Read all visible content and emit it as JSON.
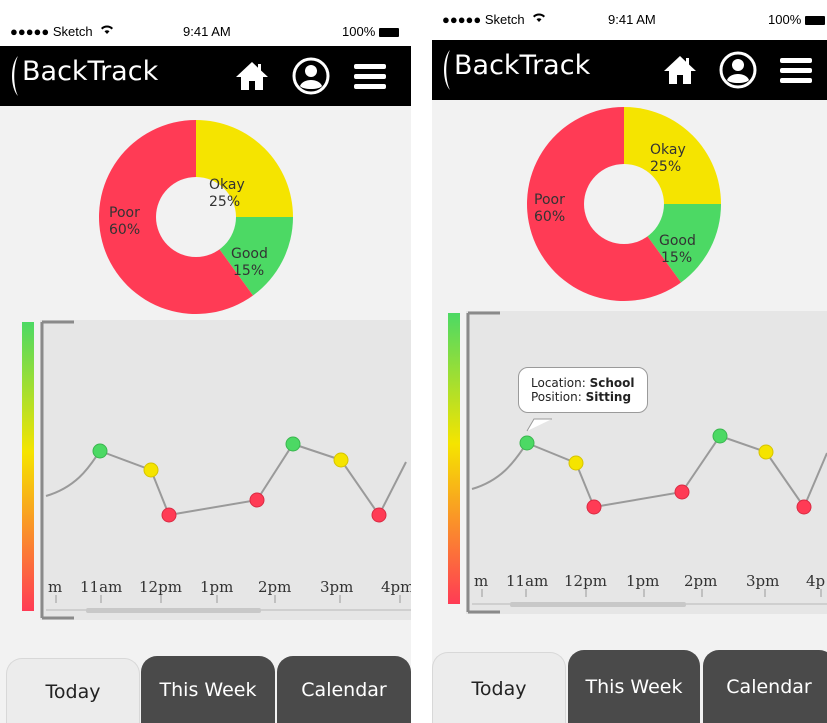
{
  "status_bar": {
    "carrier": "●●●●● Sketch",
    "time": "9:41 AM",
    "battery": "100%"
  },
  "app": {
    "title": "BackTrack"
  },
  "posture_breakdown": [
    {
      "label": "Okay",
      "percent": "25%",
      "value": 25,
      "color": "#f5e400"
    },
    {
      "label": "Good",
      "percent": "15%",
      "value": 15,
      "color": "#4cd964"
    },
    {
      "label": "Poor",
      "percent": "60%",
      "value": 60,
      "color": "#ff3b55"
    }
  ],
  "timeline": {
    "time_labels_left": [
      "m",
      "11am",
      "12pm",
      "1pm",
      "2pm",
      "3pm",
      "4pm"
    ],
    "time_labels_right": [
      "m",
      "11am",
      "12pm",
      "1pm",
      "2pm",
      "3pm",
      "4p"
    ]
  },
  "tooltip": {
    "location_label": "Location:",
    "location_value": "School",
    "position_label": "Position:",
    "position_value": "Sitting"
  },
  "tabs": [
    {
      "label": "Today",
      "active": true
    },
    {
      "label": "This Week",
      "active": false
    },
    {
      "label": "Calendar",
      "active": false
    }
  ],
  "icons": {
    "home": "home-icon",
    "profile": "user-profile-icon",
    "menu": "hamburger-menu-icon"
  }
}
